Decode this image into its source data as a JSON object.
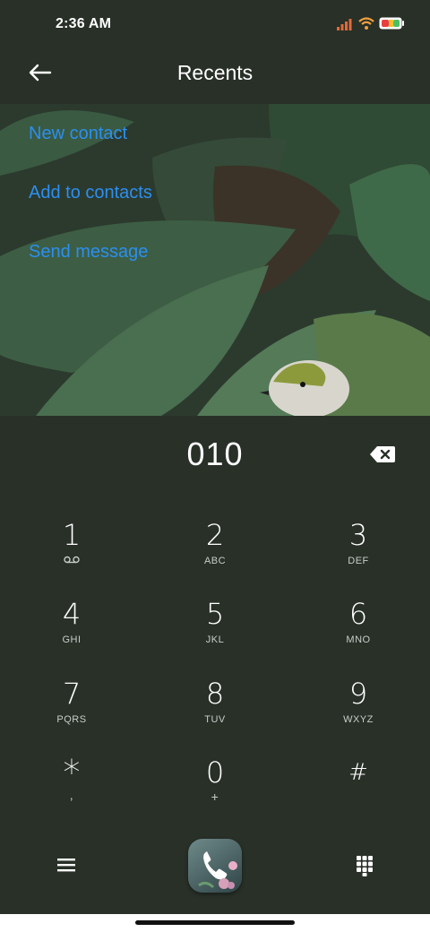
{
  "status_bar": {
    "time": "2:36 AM"
  },
  "app_bar": {
    "title": "Recents"
  },
  "options": [
    {
      "label": "New contact"
    },
    {
      "label": "Add to contacts"
    },
    {
      "label": "Send message"
    }
  ],
  "dialer": {
    "number": "010",
    "keys": [
      {
        "digit": "1",
        "letters": ""
      },
      {
        "digit": "2",
        "letters": "ABC"
      },
      {
        "digit": "3",
        "letters": "DEF"
      },
      {
        "digit": "4",
        "letters": "GHI"
      },
      {
        "digit": "5",
        "letters": "JKL"
      },
      {
        "digit": "6",
        "letters": "MNO"
      },
      {
        "digit": "7",
        "letters": "PQRS"
      },
      {
        "digit": "8",
        "letters": "TUV"
      },
      {
        "digit": "9",
        "letters": "WXYZ"
      },
      {
        "digit": "*",
        "letters": ","
      },
      {
        "digit": "0",
        "letters": "+"
      },
      {
        "digit": "#",
        "letters": ""
      }
    ]
  },
  "colors": {
    "background": "#283028",
    "accent": "#2b8ff0",
    "text": "#ffffff"
  },
  "icons": [
    "signal-icon",
    "wifi-icon",
    "battery-icon",
    "back-arrow-icon",
    "backspace-icon",
    "voicemail-icon",
    "menu-icon",
    "phone-icon",
    "dialpad-icon"
  ]
}
